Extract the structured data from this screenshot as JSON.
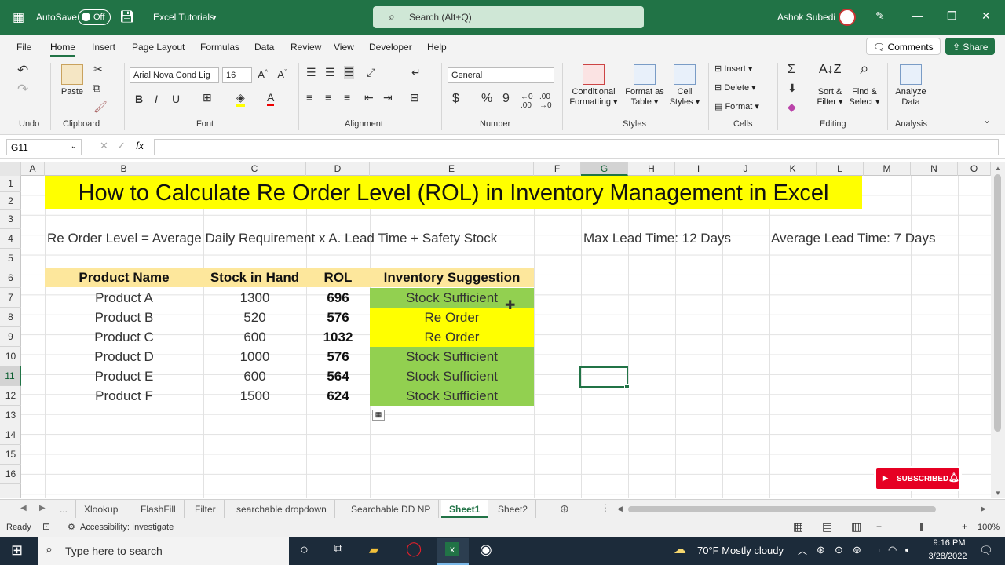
{
  "titlebar": {
    "autosave": "AutoSave",
    "autosave_state": "Off",
    "doc_title": "Excel Tutorials",
    "search_placeholder": "Search (Alt+Q)",
    "user": "Ashok Subedi"
  },
  "menu": {
    "items": [
      "File",
      "Home",
      "Insert",
      "Page Layout",
      "Formulas",
      "Data",
      "Review",
      "View",
      "Developer",
      "Help"
    ],
    "comments": "Comments",
    "share": "Share"
  },
  "ribbon": {
    "undo": "Undo",
    "clipboard": "Clipboard",
    "paste": "Paste",
    "font": "Font",
    "font_name": "Arial Nova Cond Lig",
    "font_size": "16",
    "alignment": "Alignment",
    "number": "Number",
    "number_format": "General",
    "cond_fmt_1": "Conditional",
    "cond_fmt_2": "Formatting",
    "fmt_table_1": "Format as",
    "fmt_table_2": "Table",
    "cell_styles_1": "Cell",
    "cell_styles_2": "Styles",
    "styles": "Styles",
    "insert": "Insert",
    "delete": "Delete",
    "format": "Format",
    "cells": "Cells",
    "sort_1": "Sort &",
    "sort_2": "Filter",
    "find_1": "Find &",
    "find_2": "Select",
    "editing": "Editing",
    "analyze_1": "Analyze",
    "analyze_2": "Data",
    "analysis": "Analysis"
  },
  "formula": {
    "namebox": "G11",
    "fx": "fx",
    "value": ""
  },
  "columns": [
    "A",
    "B",
    "C",
    "D",
    "E",
    "F",
    "G",
    "H",
    "I",
    "J",
    "K",
    "L",
    "M",
    "N",
    "O"
  ],
  "rows": [
    "1",
    "2",
    "3",
    "4",
    "5",
    "6",
    "7",
    "8",
    "9",
    "10",
    "11",
    "12",
    "13",
    "14",
    "15",
    "16"
  ],
  "sheet": {
    "title": "How to Calculate Re Order Level (ROL) in Inventory Management in Excel",
    "formula_text": "Re Order Level = Average Daily Requirement x A. Lead Time + Safety Stock",
    "max_lead": "Max Lead Time: 12 Days",
    "avg_lead": "Average Lead Time: 7 Days",
    "headers": [
      "Product Name",
      "Stock in Hand",
      "ROL",
      "Inventory Suggestion"
    ],
    "table": [
      {
        "product": "Product A",
        "stock": "1300",
        "rol": "696",
        "suggestion": "Stock Sufficient",
        "color": "#92d050"
      },
      {
        "product": "Product B",
        "stock": "520",
        "rol": "576",
        "suggestion": "Re Order",
        "color": "#ffff00"
      },
      {
        "product": "Product C",
        "stock": "600",
        "rol": "1032",
        "suggestion": "Re Order",
        "color": "#ffff00"
      },
      {
        "product": "Product D",
        "stock": "1000",
        "rol": "576",
        "suggestion": "Stock Sufficient",
        "color": "#92d050"
      },
      {
        "product": "Product E",
        "stock": "600",
        "rol": "564",
        "suggestion": "Stock Sufficient",
        "color": "#92d050"
      },
      {
        "product": "Product F",
        "stock": "1500",
        "rol": "624",
        "suggestion": "Stock Sufficient",
        "color": "#92d050"
      }
    ]
  },
  "tabs": [
    "...",
    "Xlookup",
    "FlashFill",
    "Filter",
    "searchable dropdown",
    "Searchable DD NP",
    "Sheet1",
    "Sheet2"
  ],
  "status": {
    "ready": "Ready",
    "accessibility": "Accessibility: Investigate",
    "zoom": "100%"
  },
  "overlay": {
    "subscribed": "SUBSCRIBED"
  },
  "taskbar": {
    "search": "Type here to search",
    "weather": "70°F  Mostly cloudy",
    "time": "9:16 PM",
    "date": "3/28/2022"
  },
  "colors": {
    "excel_green": "#217346",
    "yellow": "#ffff00",
    "green_fill": "#92d050",
    "header_fill": "#fde79c"
  }
}
